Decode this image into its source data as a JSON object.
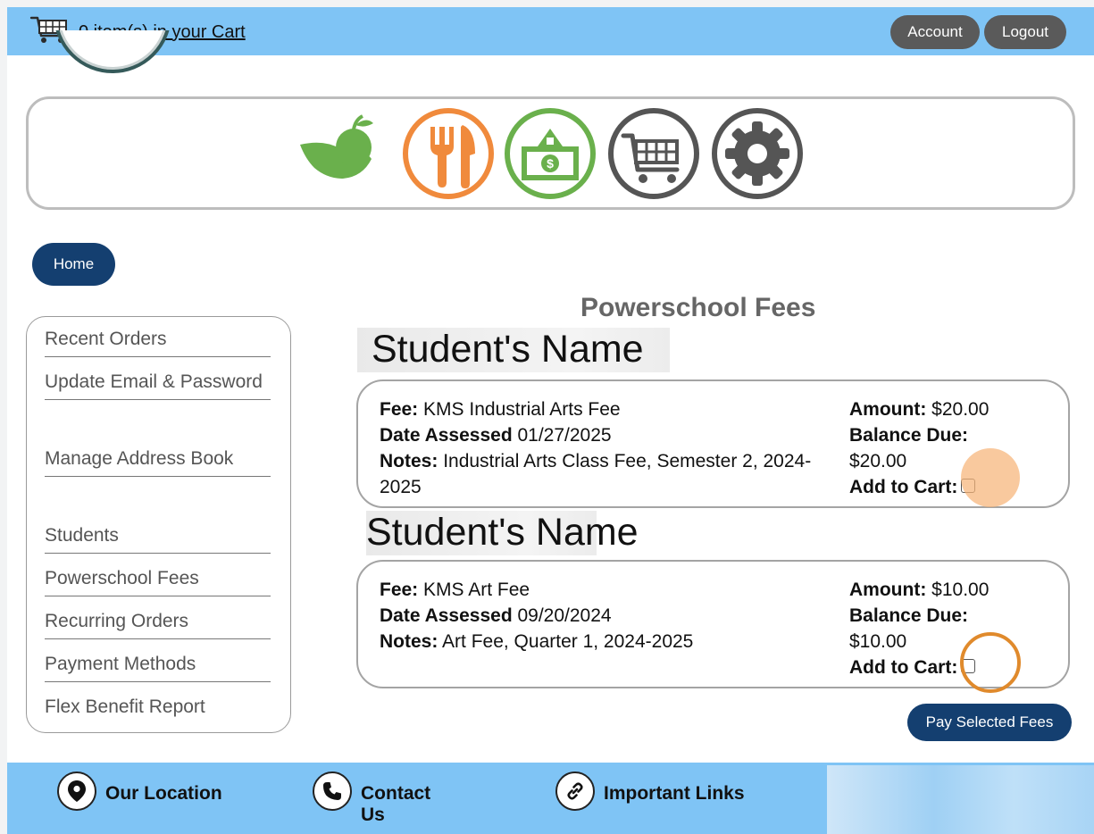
{
  "header": {
    "cart_text": "0 item(s) in your Cart",
    "account_label": "Account",
    "logout_label": "Logout"
  },
  "banner": {
    "icons": [
      "nutrition-apple-hand-icon",
      "meals-fork-knife-icon",
      "payment-money-icon",
      "cart-icon",
      "settings-gear-icon"
    ],
    "colors": {
      "green": "#6ab04c",
      "orange": "#f08a3c",
      "gray": "#555555"
    }
  },
  "nav": {
    "home_label": "Home"
  },
  "sidebar": {
    "items": [
      {
        "label": "Recent Orders"
      },
      {
        "label": "Update Email & Password"
      },
      {
        "label": "Manage Address Book"
      },
      {
        "label": "Students"
      },
      {
        "label": "Powerschool Fees"
      },
      {
        "label": "Recurring Orders"
      },
      {
        "label": "Payment Methods"
      },
      {
        "label": "Flex Benefit Report"
      }
    ]
  },
  "main": {
    "title": "Powerschool Fees",
    "fees": [
      {
        "student": "Student's Name",
        "fee_label": "Fee:",
        "fee": "KMS Industrial Arts Fee",
        "date_label": "Date Assessed",
        "date": "01/27/2025",
        "notes_label": "Notes:",
        "notes": "Industrial Arts Class Fee, Semester 2, 2024-2025",
        "amount_label": "Amount:",
        "amount": "$20.00",
        "balance_label": "Balance Due:",
        "balance": "$20.00",
        "cart_label": "Add to Cart:",
        "checked": false
      },
      {
        "student": "Student's Name",
        "fee_label": "Fee:",
        "fee": "KMS Art Fee",
        "date_label": "Date Assessed",
        "date": "09/20/2024",
        "notes_label": "Notes:",
        "notes": "Art Fee, Quarter 1, 2024-2025",
        "amount_label": "Amount:",
        "amount": "$10.00",
        "balance_label": "Balance Due:",
        "balance": "$10.00",
        "cart_label": "Add to Cart:",
        "checked": false
      }
    ],
    "pay_label": "Pay Selected Fees"
  },
  "footer": {
    "location_label": "Our Location",
    "contact_label": "Contact Us",
    "links_label": "Important Links"
  },
  "colors": {
    "topbar": "#7fc4f5",
    "navy_button": "#143f70",
    "pill_button": "#5a5a5a",
    "highlight": "#e08a2c"
  }
}
